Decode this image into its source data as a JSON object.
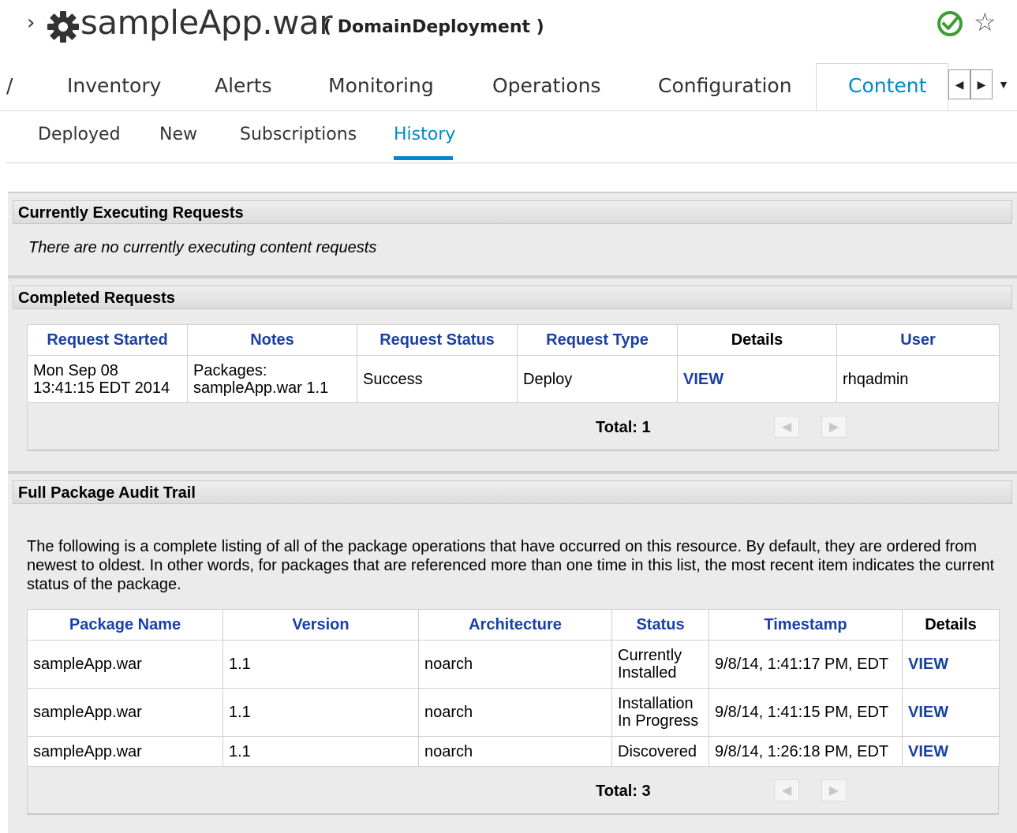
{
  "header": {
    "chevron": "›",
    "app_name": "sampleApp.war",
    "app_type": "( DomainDeployment )",
    "icons": {
      "resource": "gear-icon",
      "availability": "check-circle-icon",
      "favorite": "star-outline-icon"
    },
    "colors": {
      "accent": "#0088ce",
      "ok": "#3f9c35",
      "link": "#1a40a6"
    }
  },
  "main_tabs": {
    "cut_off": "/",
    "items": [
      {
        "label": "Inventory"
      },
      {
        "label": "Alerts"
      },
      {
        "label": "Monitoring"
      },
      {
        "label": "Operations"
      },
      {
        "label": "Configuration"
      },
      {
        "label": "Content",
        "active": true
      }
    ],
    "scroll_left": "◀",
    "scroll_right": "▶",
    "menu": "▼"
  },
  "sub_tabs": {
    "items": [
      {
        "label": "Deployed"
      },
      {
        "label": "New"
      },
      {
        "label": "Subscriptions"
      },
      {
        "label": "History",
        "active": true
      }
    ]
  },
  "executing": {
    "title": "Currently Executing Requests",
    "empty_message": "There are no currently executing content requests"
  },
  "completed": {
    "title": "Completed Requests",
    "columns": [
      "Request Started",
      "Notes",
      "Request Status",
      "Request Type",
      "Details",
      "User"
    ],
    "rows": [
      {
        "started_line1": "Mon Sep 08",
        "started_line2": "13:41:15 EDT 2014",
        "notes_line1": "Packages:",
        "notes_line2": "sampleApp.war 1.1",
        "status": "Success",
        "type": "Deploy",
        "details": "VIEW",
        "user": "rhqadmin"
      }
    ],
    "total": "Total: 1",
    "prev": "◀",
    "next": "▶"
  },
  "audit": {
    "title": "Full Package Audit Trail",
    "description": "The following is a complete listing of all of the package operations that have occurred on this resource. By default, they are ordered from newest to oldest. In other words, for packages that are referenced more than one time in this list, the most recent item indicates the current status of the package.",
    "columns": [
      "Package Name",
      "Version",
      "Architecture",
      "Status",
      "Timestamp",
      "Details"
    ],
    "rows": [
      {
        "name": "sampleApp.war",
        "version": "1.1",
        "arch": "noarch",
        "status_line1": "Currently",
        "status_line2": "Installed",
        "timestamp": "9/8/14, 1:41:17 PM, EDT",
        "details": "VIEW"
      },
      {
        "name": "sampleApp.war",
        "version": "1.1",
        "arch": "noarch",
        "status_line1": "Installation",
        "status_line2": "In Progress",
        "timestamp": "9/8/14, 1:41:15 PM, EDT",
        "details": "VIEW"
      },
      {
        "name": "sampleApp.war",
        "version": "1.1",
        "arch": "noarch",
        "status_line1": "Discovered",
        "status_line2": "",
        "timestamp": "9/8/14, 1:26:18 PM, EDT",
        "details": "VIEW"
      }
    ],
    "total": "Total: 3",
    "prev": "◀",
    "next": "▶"
  }
}
